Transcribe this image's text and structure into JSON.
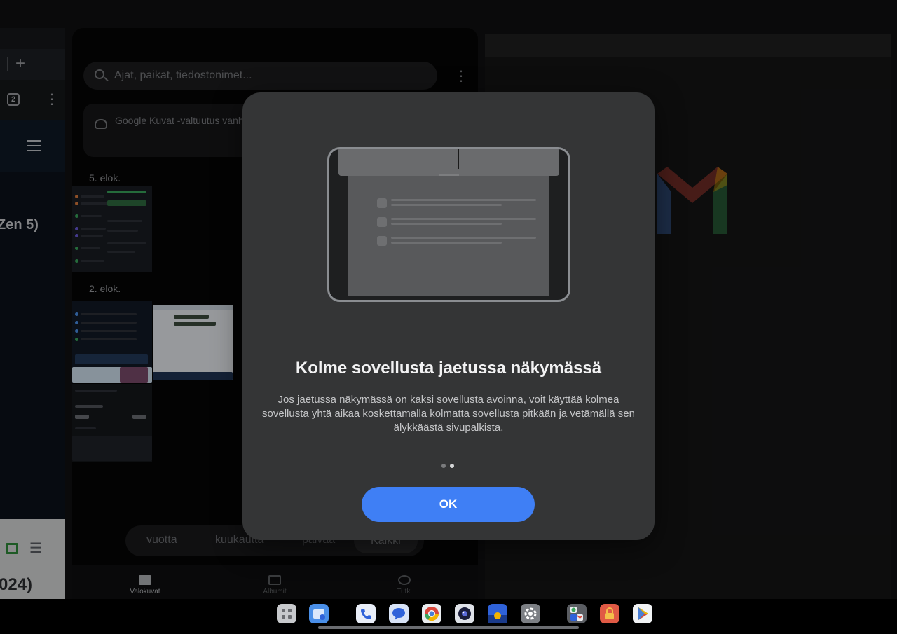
{
  "left_pane": {
    "tab_count": "2",
    "plus_label": "+",
    "kebab_label": "⋮",
    "title_top": "Zen 5)",
    "title_bottom": "024)"
  },
  "gallery": {
    "search_placeholder": "Ajat, paikat, tiedostonimet...",
    "kebab_label": "⋮",
    "cloud_notice": "Google Kuvat -valtuutus vanh",
    "date_groups": [
      {
        "label": "5. elok."
      },
      {
        "label": "2. elok."
      }
    ],
    "time_tabs": [
      "vuotta",
      "kuukautta",
      "päivää",
      "Kaikki"
    ],
    "active_time_tab": "Kaikki",
    "bottom_nav": [
      {
        "label": "Valokuvat",
        "icon": "photos-icon",
        "active": true
      },
      {
        "label": "Albumit",
        "icon": "albums-icon",
        "active": false
      },
      {
        "label": "Tutki",
        "icon": "explore-icon",
        "active": false
      }
    ]
  },
  "dialog": {
    "title": "Kolme sovellusta jaetussa näkymässä",
    "body": "Jos jaetussa näkymässä on kaksi sovellusta avoinna, voit käyttää kolmea sovellusta yhtä aikaa koskettamalla kolmatta sovellusta pitkään ja vetämällä sen älykkäästä sivupalkista.",
    "pages_total": 2,
    "current_page": 2,
    "ok_label": "OK"
  },
  "dock": {
    "apps": [
      {
        "name": "app-drawer-icon",
        "color": "#c7c9cc"
      },
      {
        "name": "files-icon",
        "color": "#4a8fe8"
      },
      {
        "name": "phone-icon",
        "color": "#e9eef8"
      },
      {
        "name": "messages-icon",
        "color": "#d8e3f7"
      },
      {
        "name": "chrome-icon",
        "color": "#e9ecef"
      },
      {
        "name": "camera-icon",
        "color": "#dfe2e8"
      },
      {
        "name": "weather-icon",
        "color": "#2f62d9"
      },
      {
        "name": "settings-icon",
        "color": "#7c7f84"
      },
      {
        "name": "app-pair-icon",
        "color": "#5a5d62"
      },
      {
        "name": "secure-folder-icon",
        "color": "#e05a45"
      },
      {
        "name": "play-store-icon",
        "color": "#f1f3f5"
      }
    ]
  },
  "colors": {
    "accent": "#3f7ff5",
    "dialog_bg": "#343536"
  }
}
